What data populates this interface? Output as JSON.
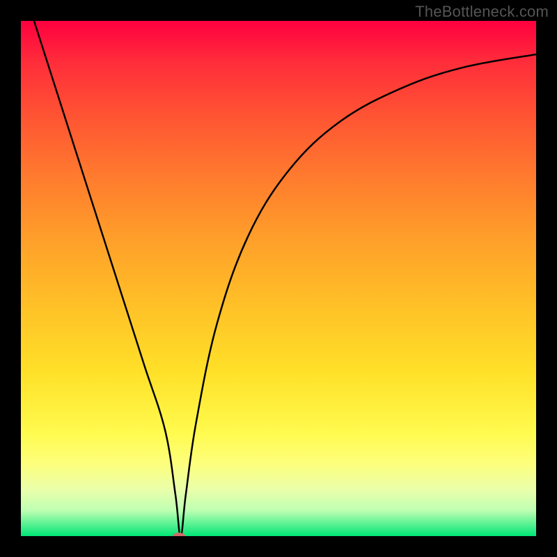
{
  "watermark": "TheBottleneck.com",
  "chart_data": {
    "type": "line",
    "title": "",
    "xlabel": "",
    "ylabel": "",
    "xlim": [
      0,
      100
    ],
    "ylim": [
      0,
      100
    ],
    "grid": false,
    "series": [
      {
        "name": "bottleneck-curve",
        "x": [
          0,
          4,
          8,
          12,
          16,
          20,
          24,
          28,
          30,
          31,
          32,
          34,
          38,
          44,
          52,
          62,
          74,
          86,
          100
        ],
        "y": [
          108,
          95.5,
          83,
          70.5,
          58,
          45.5,
          33,
          20.5,
          8,
          0,
          8,
          22,
          41,
          58,
          71,
          80.5,
          87,
          91,
          93.5
        ]
      }
    ],
    "notch_x": 31,
    "marker": {
      "x": 30.7,
      "y": 0,
      "color": "#d36a6a"
    },
    "background_gradient": {
      "stops": [
        {
          "pos": 0.0,
          "color": "#ff003f"
        },
        {
          "pos": 0.18,
          "color": "#ff5233"
        },
        {
          "pos": 0.42,
          "color": "#ff9e2a"
        },
        {
          "pos": 0.68,
          "color": "#ffe028"
        },
        {
          "pos": 0.86,
          "color": "#fdff7d"
        },
        {
          "pos": 1.0,
          "color": "#00e676"
        }
      ]
    }
  }
}
